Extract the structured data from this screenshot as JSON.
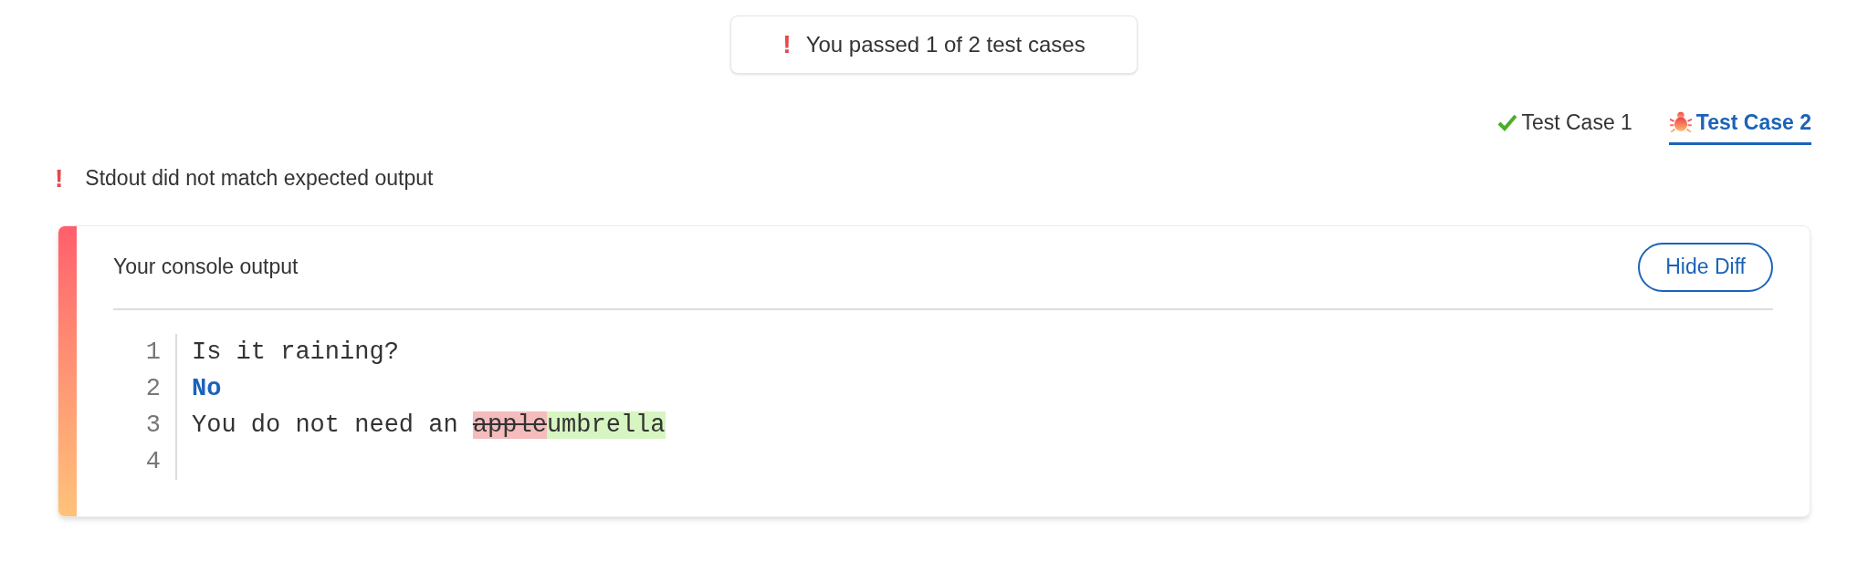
{
  "banner": {
    "icon": "!",
    "text": "You passed 1 of 2 test cases"
  },
  "test_cases": [
    {
      "label": "Test Case 1",
      "passed": true,
      "selected": false
    },
    {
      "label": "Test Case 2",
      "passed": false,
      "selected": true
    }
  ],
  "error": {
    "icon": "!",
    "text": "Stdout did not match expected output"
  },
  "console": {
    "title": "Your console output",
    "button": "Hide Diff",
    "lines": [
      {
        "number": "1",
        "segments": [
          {
            "kind": "plain",
            "text": "Is it raining?"
          }
        ]
      },
      {
        "number": "2",
        "segments": [
          {
            "kind": "keyword",
            "text": "No"
          }
        ]
      },
      {
        "number": "3",
        "segments": [
          {
            "kind": "plain",
            "text": "You do not need an "
          },
          {
            "kind": "removed",
            "text": "apple"
          },
          {
            "kind": "added",
            "text": "umbrella"
          }
        ]
      },
      {
        "number": "4"
      }
    ]
  }
}
